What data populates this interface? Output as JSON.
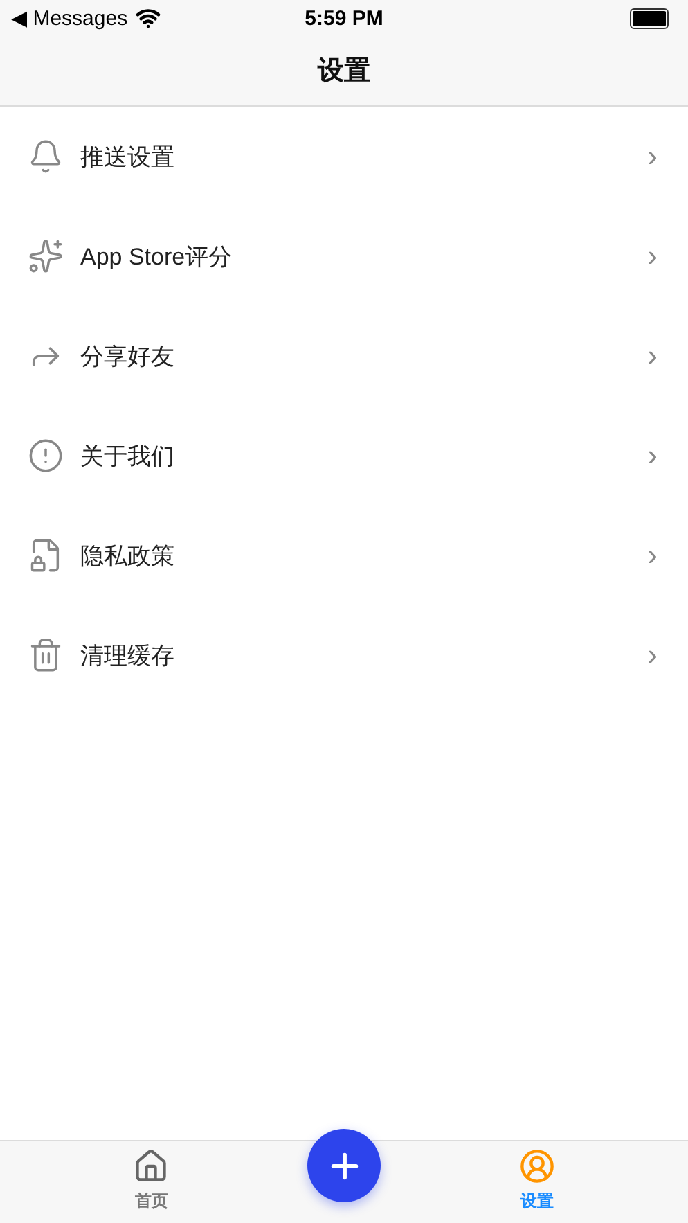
{
  "status_bar": {
    "back_label": "◀ Messages",
    "time": "5:59 PM"
  },
  "nav": {
    "title": "设置"
  },
  "items": [
    {
      "label": "推送设置",
      "chevron": "›"
    },
    {
      "label": "App Store评分",
      "chevron": "›"
    },
    {
      "label": "分享好友",
      "chevron": "›"
    },
    {
      "label": "关于我们",
      "chevron": "›"
    },
    {
      "label": "隐私政策",
      "chevron": "›"
    },
    {
      "label": "清理缓存",
      "chevron": "›"
    }
  ],
  "tab_bar": {
    "tabs": [
      {
        "label": "首页",
        "selected": false
      },
      {
        "label": "设置",
        "selected": true
      }
    ]
  }
}
